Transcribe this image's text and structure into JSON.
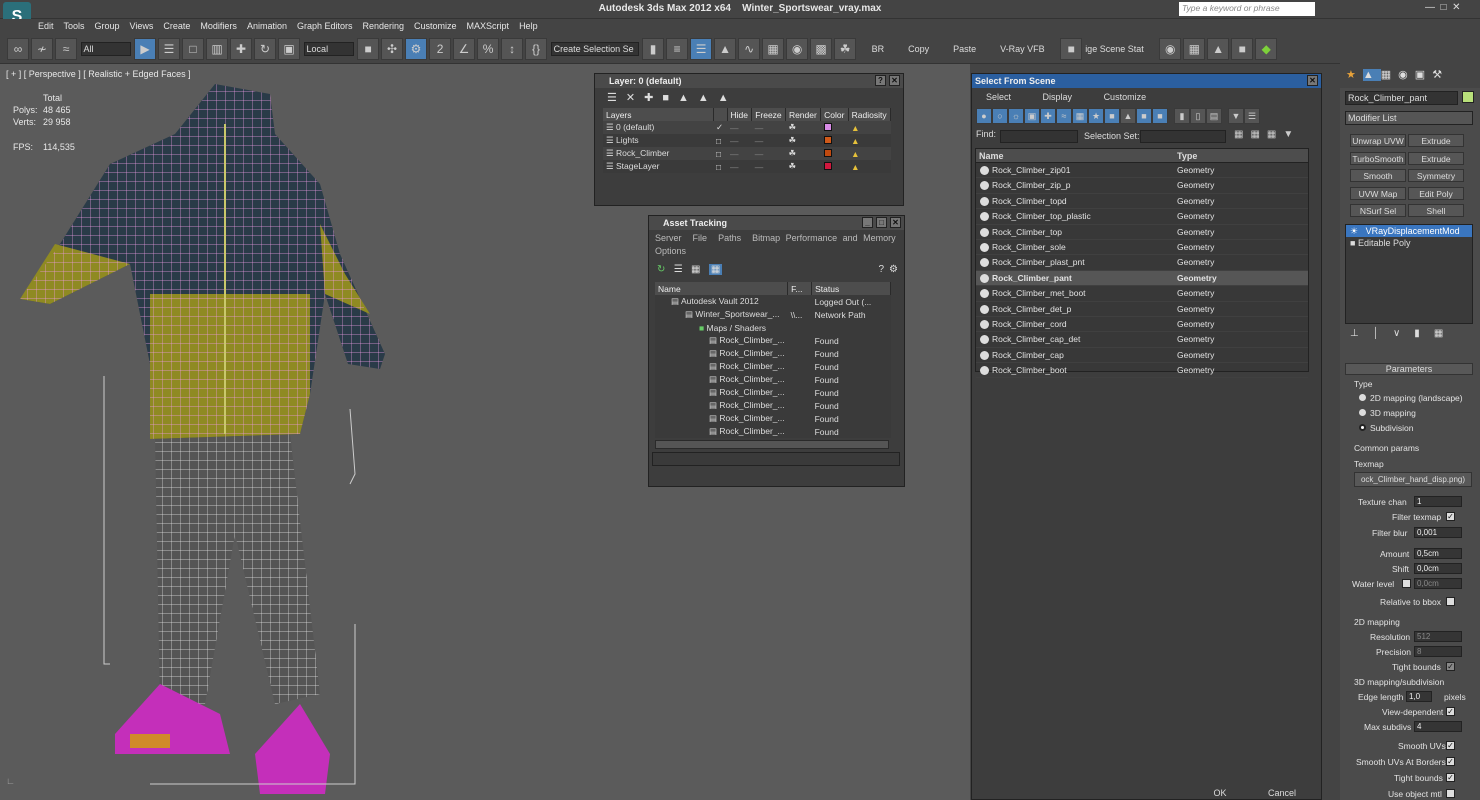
{
  "app": {
    "title": "Autodesk 3ds Max  2012 x64",
    "file": "Winter_Sportswear_vray.max",
    "search_placeholder": "Type a keyword or phrase"
  },
  "menu": [
    "Edit",
    "Tools",
    "Group",
    "Views",
    "Create",
    "Modifiers",
    "Animation",
    "Graph Editors",
    "Rendering",
    "Customize",
    "MAXScript",
    "Help"
  ],
  "toolbar": {
    "filter": "All",
    "coord": "Local",
    "selset": "Create Selection Se",
    "br": "BR",
    "copy": "Copy",
    "paste": "Paste",
    "vrayvfb": "V-Ray VFB",
    "scene": "ige Scene Stat"
  },
  "viewport": {
    "label": "[ + ] [ Perspective ] [ Realistic + Edged Faces ]",
    "total": "Total",
    "polys_label": "Polys:",
    "polys": "48 465",
    "verts_label": "Verts:",
    "verts": "29 958",
    "fps_label": "FPS:",
    "fps": "114,535"
  },
  "layer": {
    "title": "Layer: 0 (default)",
    "cols": [
      "Layers",
      "Hide",
      "Freeze",
      "Render",
      "Color",
      "Radiosity"
    ],
    "rows": [
      {
        "name": "0 (default)",
        "color": "#d88be6"
      },
      {
        "name": "Lights",
        "color": "#d05a1a"
      },
      {
        "name": "Rock_Climber",
        "color": "#c04a10"
      },
      {
        "name": "StageLayer",
        "color": "#d0183e"
      }
    ]
  },
  "asset": {
    "title": "Asset Tracking",
    "menu": [
      "Server",
      "File",
      "Paths",
      "Bitmap Performance and Memory"
    ],
    "menu2": "Options",
    "cols": [
      "Name",
      "F...",
      "Status"
    ],
    "rows": [
      {
        "name": "Autodesk Vault 2012",
        "f": "",
        "status": "Logged Out (..."
      },
      {
        "name": "Winter_Sportswear_...",
        "f": "\\\\...",
        "status": "Network Path"
      },
      {
        "name": "Maps / Shaders",
        "f": "",
        "status": ""
      },
      {
        "name": "Rock_Climber_...",
        "f": "",
        "status": "Found"
      },
      {
        "name": "Rock_Climber_...",
        "f": "",
        "status": "Found"
      },
      {
        "name": "Rock_Climber_...",
        "f": "",
        "status": "Found"
      },
      {
        "name": "Rock_Climber_...",
        "f": "",
        "status": "Found"
      },
      {
        "name": "Rock_Climber_...",
        "f": "",
        "status": "Found"
      },
      {
        "name": "Rock_Climber_...",
        "f": "",
        "status": "Found"
      },
      {
        "name": "Rock_Climber_...",
        "f": "",
        "status": "Found"
      },
      {
        "name": "Rock_Climber_...",
        "f": "",
        "status": "Found"
      }
    ]
  },
  "sfs": {
    "title": "Select From Scene",
    "menu": [
      "Select",
      "Display",
      "Customize"
    ],
    "find": "Find:",
    "selset": "Selection Set:",
    "col_name": "Name",
    "col_type": "Type",
    "ok": "OK",
    "cancel": "Cancel",
    "rows": [
      {
        "name": "Rock_Climber_zip01",
        "type": "Geometry"
      },
      {
        "name": "Rock_Climber_zip_p",
        "type": "Geometry"
      },
      {
        "name": "Rock_Climber_topd",
        "type": "Geometry"
      },
      {
        "name": "Rock_Climber_top_plastic",
        "type": "Geometry"
      },
      {
        "name": "Rock_Climber_top",
        "type": "Geometry"
      },
      {
        "name": "Rock_Climber_sole",
        "type": "Geometry"
      },
      {
        "name": "Rock_Climber_plast_pnt",
        "type": "Geometry"
      },
      {
        "name": "Rock_Climber_pant",
        "type": "Geometry"
      },
      {
        "name": "Rock_Climber_met_boot",
        "type": "Geometry"
      },
      {
        "name": "Rock_Climber_det_p",
        "type": "Geometry"
      },
      {
        "name": "Rock_Climber_cord",
        "type": "Geometry"
      },
      {
        "name": "Rock_Climber_cap_det",
        "type": "Geometry"
      },
      {
        "name": "Rock_Climber_cap",
        "type": "Geometry"
      },
      {
        "name": "Rock_Climber_boot",
        "type": "Geometry"
      }
    ]
  },
  "cmd": {
    "object": "Rock_Climber_pant",
    "modlist": "Modifier List",
    "buttons": [
      "Unwrap UVW",
      "Extrude",
      "TurboSmooth",
      "Extrude",
      "Smooth",
      "Symmetry",
      "UVW Map",
      "Edit Poly",
      "NSurf Sel",
      "Shell"
    ],
    "stack": [
      "VRayDisplacementMod",
      "Editable Poly"
    ],
    "params": "Parameters",
    "type": "Type",
    "r1": "2D mapping (landscape)",
    "r2": "3D mapping",
    "r3": "Subdivision",
    "common": "Common params",
    "texmap": "Texmap",
    "texmap_val": "ock_Climber_hand_disp.png)",
    "texchan": "Texture chan",
    "texchan_val": "1",
    "filtertex": "Filter texmap",
    "filterblur": "Filter blur",
    "filterblur_val": "0,001",
    "amount": "Amount",
    "amount_val": "0,5cm",
    "shift": "Shift",
    "shift_val": "0,0cm",
    "water": "Water level",
    "water_val": "0,0cm",
    "relbbox": "Relative to bbox",
    "m2d": "2D mapping",
    "res": "Resolution",
    "res_val": "512",
    "prec": "Precision",
    "prec_val": "8",
    "tight": "Tight bounds",
    "m3d": "3D mapping/subdivision",
    "edge": "Edge length",
    "edge_val": "1,0",
    "pixels": "pixels",
    "viewdep": "View-dependent",
    "maxsub": "Max subdivs",
    "maxsub_val": "4",
    "smoothuv": "Smooth UVs",
    "smoothuvb": "Smooth UVs At Borders",
    "tight2": "Tight bounds",
    "useobj": "Use object mtl"
  }
}
